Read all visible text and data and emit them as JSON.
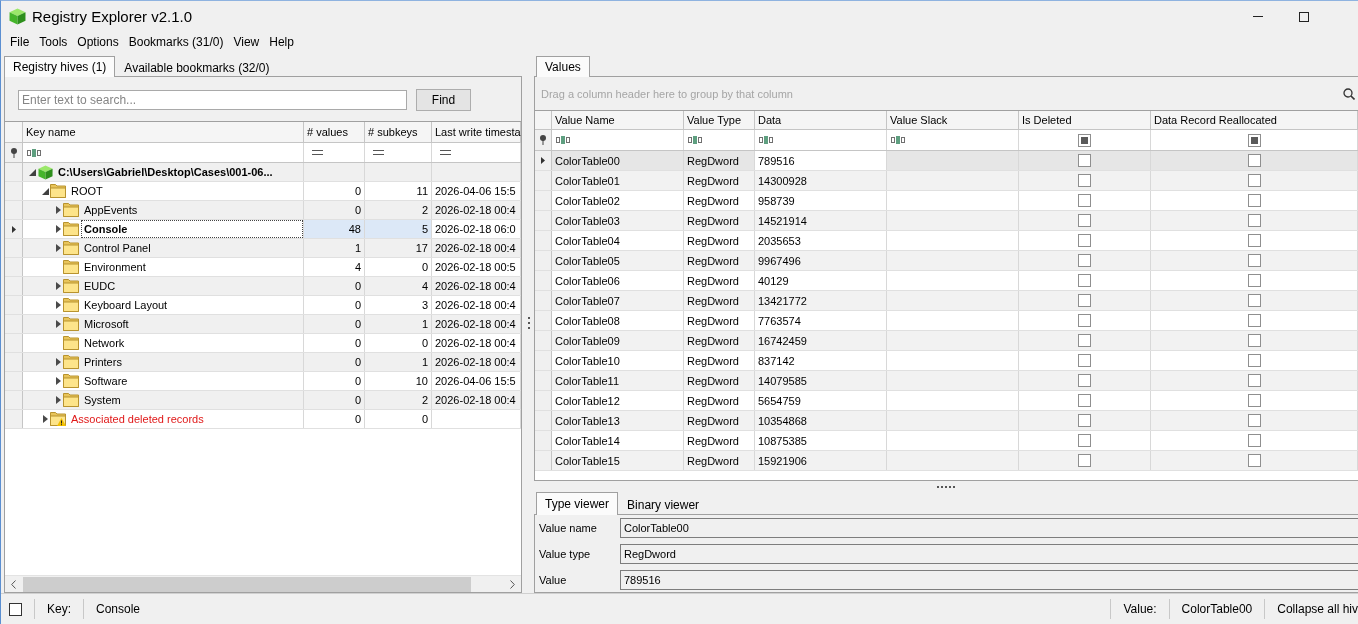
{
  "window": {
    "title": "Registry Explorer v2.1.0"
  },
  "menu": [
    "File",
    "Tools",
    "Options",
    "Bookmarks (31/0)",
    "View",
    "Help"
  ],
  "hives_panel": {
    "tabs": [
      {
        "label": "Registry hives (1)",
        "selected": true
      },
      {
        "label": "Available bookmarks (32/0)",
        "selected": false
      }
    ],
    "search": {
      "placeholder": "Enter text to search...",
      "button": "Find"
    },
    "columns": [
      {
        "label": "Key name",
        "kind": "text"
      },
      {
        "label": "# values",
        "kind": "equals"
      },
      {
        "label": "# subkeys",
        "kind": "equals"
      },
      {
        "label": "Last write timesta",
        "kind": "equals"
      }
    ],
    "tree": [
      {
        "kind": "hive",
        "name": "C:\\Users\\Gabriel\\Desktop\\Cases\\001-06...",
        "expandable": true,
        "expanded": true,
        "selected": false,
        "children": [
          {
            "kind": "key",
            "name": "ROOT",
            "values": "0",
            "subkeys": "11",
            "timestamp": "2026-04-06 15:5",
            "expandable": true,
            "expanded": true,
            "selected": false,
            "children": [
              {
                "kind": "key",
                "name": "AppEvents",
                "values": "0",
                "subkeys": "2",
                "timestamp": "2026-02-18 00:4",
                "expandable": true,
                "expanded": false,
                "selected": false
              },
              {
                "kind": "key",
                "name": "Console",
                "values": "48",
                "subkeys": "5",
                "timestamp": "2026-02-18 06:0",
                "expandable": true,
                "expanded": false,
                "selected": true
              },
              {
                "kind": "key",
                "name": "Control Panel",
                "values": "1",
                "subkeys": "17",
                "timestamp": "2026-02-18 00:4",
                "expandable": true,
                "expanded": false,
                "selected": false
              },
              {
                "kind": "key",
                "name": "Environment",
                "values": "4",
                "subkeys": "0",
                "timestamp": "2026-02-18 00:5",
                "expandable": false,
                "expanded": false,
                "selected": false
              },
              {
                "kind": "key",
                "name": "EUDC",
                "values": "0",
                "subkeys": "4",
                "timestamp": "2026-02-18 00:4",
                "expandable": true,
                "expanded": false,
                "selected": false
              },
              {
                "kind": "key",
                "name": "Keyboard Layout",
                "values": "0",
                "subkeys": "3",
                "timestamp": "2026-02-18 00:4",
                "expandable": true,
                "expanded": false,
                "selected": false
              },
              {
                "kind": "key",
                "name": "Microsoft",
                "values": "0",
                "subkeys": "1",
                "timestamp": "2026-02-18 00:4",
                "expandable": true,
                "expanded": false,
                "selected": false
              },
              {
                "kind": "key",
                "name": "Network",
                "values": "0",
                "subkeys": "0",
                "timestamp": "2026-02-18 00:4",
                "expandable": false,
                "expanded": false,
                "selected": false
              },
              {
                "kind": "key",
                "name": "Printers",
                "values": "0",
                "subkeys": "1",
                "timestamp": "2026-02-18 00:4",
                "expandable": true,
                "expanded": false,
                "selected": false
              },
              {
                "kind": "key",
                "name": "Software",
                "values": "0",
                "subkeys": "10",
                "timestamp": "2026-04-06 15:5",
                "expandable": true,
                "expanded": false,
                "selected": false
              },
              {
                "kind": "key",
                "name": "System",
                "values": "0",
                "subkeys": "2",
                "timestamp": "2026-02-18 00:4",
                "expandable": true,
                "expanded": false,
                "selected": false
              }
            ]
          },
          {
            "kind": "deleted",
            "name": "Associated deleted records",
            "values": "0",
            "subkeys": "0",
            "expandable": true,
            "expanded": false,
            "selected": false
          }
        ]
      }
    ]
  },
  "values_panel": {
    "tabs": [
      {
        "label": "Values",
        "selected": true
      }
    ],
    "group_hint": "Drag a column header here to group by that column",
    "columns": [
      {
        "label": "Value Name",
        "kind": "text"
      },
      {
        "label": "Value Type",
        "kind": "text"
      },
      {
        "label": "Data",
        "kind": "text"
      },
      {
        "label": "Value Slack",
        "kind": "text"
      },
      {
        "label": "Is Deleted",
        "kind": "checkbox",
        "indeterminate": true
      },
      {
        "label": "Data Record Reallocated",
        "kind": "checkbox",
        "indeterminate": true
      }
    ],
    "rows": [
      {
        "name": "ColorTable00",
        "type": "RegDword",
        "data": "789516",
        "is_deleted": false,
        "data_record_reallocated": false,
        "selected": true
      },
      {
        "name": "ColorTable01",
        "type": "RegDword",
        "data": "14300928",
        "is_deleted": false,
        "data_record_reallocated": false,
        "selected": false
      },
      {
        "name": "ColorTable02",
        "type": "RegDword",
        "data": "958739",
        "is_deleted": false,
        "data_record_reallocated": false,
        "selected": false
      },
      {
        "name": "ColorTable03",
        "type": "RegDword",
        "data": "14521914",
        "is_deleted": false,
        "data_record_reallocated": false,
        "selected": false
      },
      {
        "name": "ColorTable04",
        "type": "RegDword",
        "data": "2035653",
        "is_deleted": false,
        "data_record_reallocated": false,
        "selected": false
      },
      {
        "name": "ColorTable05",
        "type": "RegDword",
        "data": "9967496",
        "is_deleted": false,
        "data_record_reallocated": false,
        "selected": false
      },
      {
        "name": "ColorTable06",
        "type": "RegDword",
        "data": "40129",
        "is_deleted": false,
        "data_record_reallocated": false,
        "selected": false
      },
      {
        "name": "ColorTable07",
        "type": "RegDword",
        "data": "13421772",
        "is_deleted": false,
        "data_record_reallocated": false,
        "selected": false
      },
      {
        "name": "ColorTable08",
        "type": "RegDword",
        "data": "7763574",
        "is_deleted": false,
        "data_record_reallocated": false,
        "selected": false
      },
      {
        "name": "ColorTable09",
        "type": "RegDword",
        "data": "16742459",
        "is_deleted": false,
        "data_record_reallocated": false,
        "selected": false
      },
      {
        "name": "ColorTable10",
        "type": "RegDword",
        "data": "837142",
        "is_deleted": false,
        "data_record_reallocated": false,
        "selected": false
      },
      {
        "name": "ColorTable11",
        "type": "RegDword",
        "data": "14079585",
        "is_deleted": false,
        "data_record_reallocated": false,
        "selected": false
      },
      {
        "name": "ColorTable12",
        "type": "RegDword",
        "data": "5654759",
        "is_deleted": false,
        "data_record_reallocated": false,
        "selected": false
      },
      {
        "name": "ColorTable13",
        "type": "RegDword",
        "data": "10354868",
        "is_deleted": false,
        "data_record_reallocated": false,
        "selected": false
      },
      {
        "name": "ColorTable14",
        "type": "RegDword",
        "data": "10875385",
        "is_deleted": false,
        "data_record_reallocated": false,
        "selected": false
      },
      {
        "name": "ColorTable15",
        "type": "RegDword",
        "data": "15921906",
        "is_deleted": false,
        "data_record_reallocated": false,
        "selected": false
      }
    ]
  },
  "viewer": {
    "tabs": [
      {
        "label": "Type viewer",
        "selected": true
      },
      {
        "label": "Binary viewer",
        "selected": false
      }
    ],
    "fields": [
      {
        "label": "Value name",
        "value": "ColorTable00"
      },
      {
        "label": "Value type",
        "value": "RegDword"
      },
      {
        "label": "Value",
        "value": "789516"
      }
    ]
  },
  "status_bar": {
    "checked": false,
    "key_label": "Key:",
    "key": "Console",
    "value_label": "Value:",
    "value": "ColorTable00",
    "action": "Collapse all hiv"
  }
}
